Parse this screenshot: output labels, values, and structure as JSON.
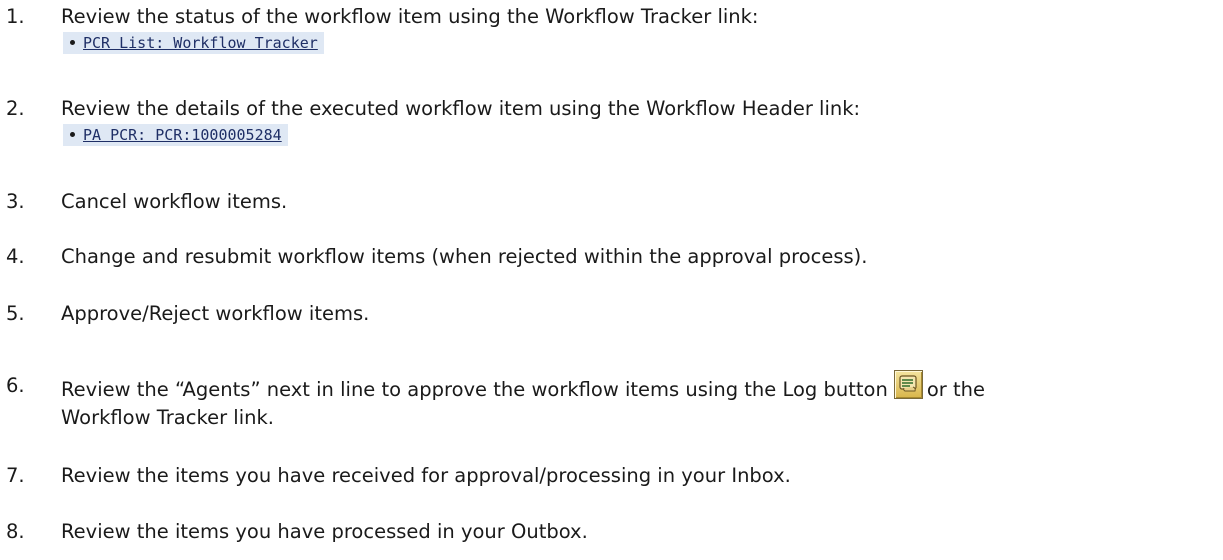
{
  "items": [
    {
      "number": "1.",
      "text": "Review the status of the workflow item using the Workflow Tracker link:",
      "link": "PCR List: Workflow Tracker"
    },
    {
      "number": "2.",
      "text": "Review the details of the executed workflow item using the Workflow Header link:",
      "link": "PA PCR: PCR:1000005284"
    },
    {
      "number": "3.",
      "text": "Cancel workflow items."
    },
    {
      "number": "4.",
      "text": "Change and resubmit workflow items (when rejected within the approval process)."
    },
    {
      "number": "5.",
      "text": "Approve/Reject workflow items."
    },
    {
      "number": "6.",
      "text_before": "Review the “Agents” next in line to approve the workflow items using the Log button",
      "text_after": "or the",
      "text_line2": "Workflow Tracker link.",
      "icon": "log-scroll-icon"
    },
    {
      "number": "7.",
      "text": "Review the items you have received for approval/processing in your Inbox."
    },
    {
      "number": "8.",
      "text": "Review the items you have processed in your Outbox."
    }
  ]
}
